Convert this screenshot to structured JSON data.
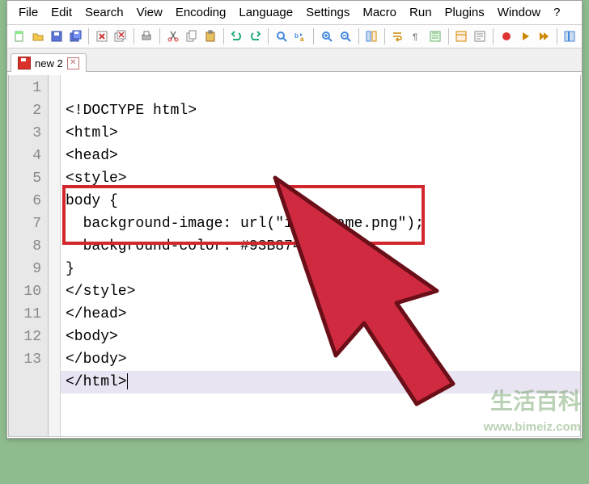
{
  "menus": [
    "File",
    "Edit",
    "Search",
    "View",
    "Encoding",
    "Language",
    "Settings",
    "Macro",
    "Run",
    "Plugins",
    "Window",
    "?"
  ],
  "toolbar_icons": [
    "new-file",
    "open-file",
    "save",
    "save-all",
    "sep",
    "close",
    "close-all",
    "sep",
    "print",
    "sep",
    "cut",
    "copy",
    "paste",
    "sep",
    "undo",
    "redo",
    "sep",
    "find",
    "replace",
    "sep",
    "zoom-in",
    "zoom-out",
    "sep",
    "sync",
    "sep",
    "word-wrap",
    "show-all",
    "indent-guide",
    "sep",
    "folder",
    "func-list",
    "sep",
    "macro-rec",
    "macro-play",
    "macro-play-multi",
    "sep",
    "toggle"
  ],
  "tab": {
    "label": "new 2"
  },
  "code": {
    "lines": [
      "<!DOCTYPE html>",
      "<html>",
      "<head>",
      "<style>",
      "body {",
      "  background-image: url(\"imagename.png\");",
      "  background-color: #93B874;",
      "}",
      "</style>",
      "</head>",
      "<body>",
      "</body>",
      "</html>"
    ],
    "line_numbers": [
      "1",
      "2",
      "3",
      "4",
      "5",
      "6",
      "7",
      "8",
      "9",
      "10",
      "11",
      "12",
      "13"
    ],
    "highlighted_line_index": 12
  },
  "watermark": {
    "text": "生活百科",
    "url": "www.bimeiz.com"
  }
}
